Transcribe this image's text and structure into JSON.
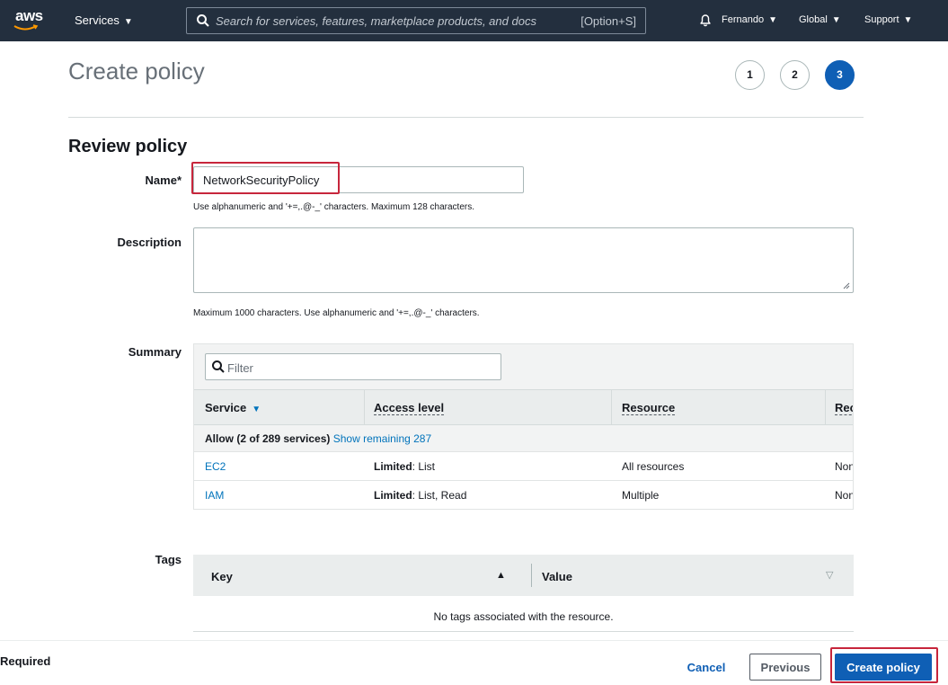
{
  "topnav": {
    "logo_text": "aws",
    "services_label": "Services",
    "search_placeholder": "Search for services, features, marketplace products, and docs",
    "search_shortcut": "[Option+S]",
    "user_label": "Fernando",
    "region_label": "Global",
    "support_label": "Support",
    "caret": "▼"
  },
  "header": {
    "title": "Create policy",
    "steps": [
      "1",
      "2",
      "3"
    ],
    "active_step": "3"
  },
  "review": {
    "section_title": "Review policy",
    "name_label": "Name*",
    "name_value": "NetworkSecurityPolicy",
    "name_hint": "Use alphanumeric and '+=,.@-_' characters. Maximum 128 characters.",
    "description_label": "Description",
    "description_value": "",
    "description_hint": "Maximum 1000 characters. Use alphanumeric and '+=,.@-_' characters.",
    "summary_label": "Summary",
    "tags_label": "Tags"
  },
  "summary": {
    "filter_placeholder": "Filter",
    "columns": [
      "Service",
      "Access level",
      "Resource",
      "Rec"
    ],
    "group_label": "Allow (2 of 289 services)",
    "group_link": "Show remaining 287",
    "rows": [
      {
        "service": "EC2",
        "access_bold": "Limited",
        "access_rest": ": List",
        "resource": "All resources",
        "condition": "Non"
      },
      {
        "service": "IAM",
        "access_bold": "Limited",
        "access_rest": ": List, Read",
        "resource": "Multiple",
        "condition": "Non"
      }
    ]
  },
  "tags": {
    "key_header": "Key",
    "value_header": "Value",
    "empty_message": "No tags associated with the resource."
  },
  "footer": {
    "required_text": "Required",
    "cancel_label": "Cancel",
    "previous_label": "Previous",
    "create_label": "Create policy"
  },
  "colors": {
    "nav_bg": "#232f3e",
    "primary": "#0f5fb5",
    "link": "#0073bb",
    "highlight": "#c7263c",
    "aws_orange": "#ff9900"
  },
  "icons": {
    "search": "search-icon",
    "bell": "bell-icon",
    "filter": "magnifier-icon",
    "resize": "resize-handle-icon",
    "sort_down": "caret-down-icon",
    "sort_up": "triangle-up-icon"
  }
}
